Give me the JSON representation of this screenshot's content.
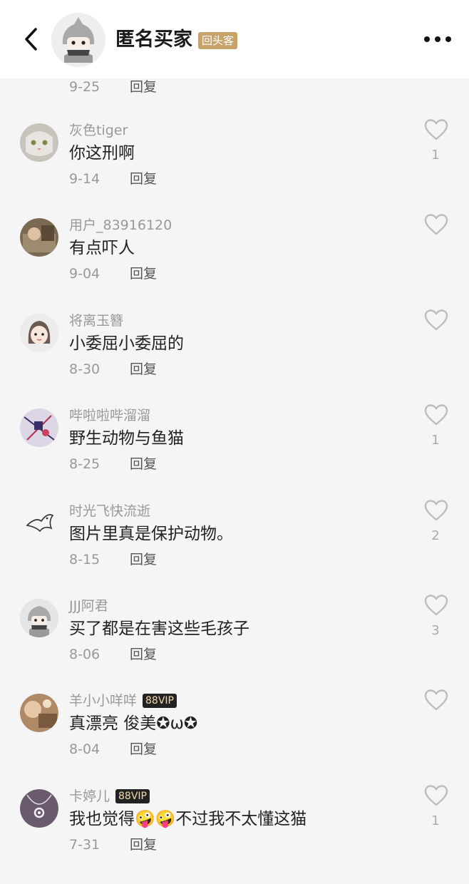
{
  "header": {
    "name": "匿名买家",
    "badge": "回头客"
  },
  "top_meta": {
    "date": "9-25",
    "reply": "回复"
  },
  "comments": [
    {
      "user": "灰色tiger",
      "vip": "",
      "text": "你这刑啊",
      "date": "9-14",
      "reply": "回复",
      "likes": "1",
      "avatar_color": "#b8b4ae"
    },
    {
      "user": "用户_83916120",
      "vip": "",
      "text": "有点吓人",
      "date": "9-04",
      "reply": "回复",
      "likes": "",
      "avatar_color": "#7a6a52"
    },
    {
      "user": "将离玉簪",
      "vip": "",
      "text": "小委屈小委屈的",
      "date": "8-30",
      "reply": "回复",
      "likes": "",
      "avatar_color": "#e8e8e8"
    },
    {
      "user": "哔啦啦哔溜溜",
      "vip": "",
      "text": "野生动物与鱼猫",
      "date": "8-25",
      "reply": "回复",
      "likes": "1",
      "avatar_color": "#c9bcd6"
    },
    {
      "user": "时光飞快流逝",
      "vip": "",
      "text": "图片里真是保护动物。",
      "date": "8-15",
      "reply": "回复",
      "likes": "2",
      "avatar_color": "#f5f5f5"
    },
    {
      "user": "JJJ阿君",
      "vip": "",
      "text": "买了都是在害这些毛孩子",
      "date": "8-06",
      "reply": "回复",
      "likes": "3",
      "avatar_color": "#e6e6e6"
    },
    {
      "user": "羊小小咩咩",
      "vip": "88VIP",
      "text": "真漂亮 俊美✪ω✪",
      "date": "8-04",
      "reply": "回复",
      "likes": "",
      "avatar_color": "#b08a66"
    },
    {
      "user": "卡婷儿",
      "vip": "88VIP",
      "text": "我也觉得🤪🤪不过我不太懂这猫",
      "date": "7-31",
      "reply": "回复",
      "likes": "1",
      "avatar_color": "#6a5a6e"
    }
  ],
  "icons": {
    "back": "chevron-left-icon",
    "more": "more-dots-icon",
    "like": "heart-outline-icon"
  },
  "colors": {
    "badge": "#c9a26a",
    "vip_bg": "#222222",
    "vip_text": "#f3d9a8",
    "muted": "#999999"
  }
}
